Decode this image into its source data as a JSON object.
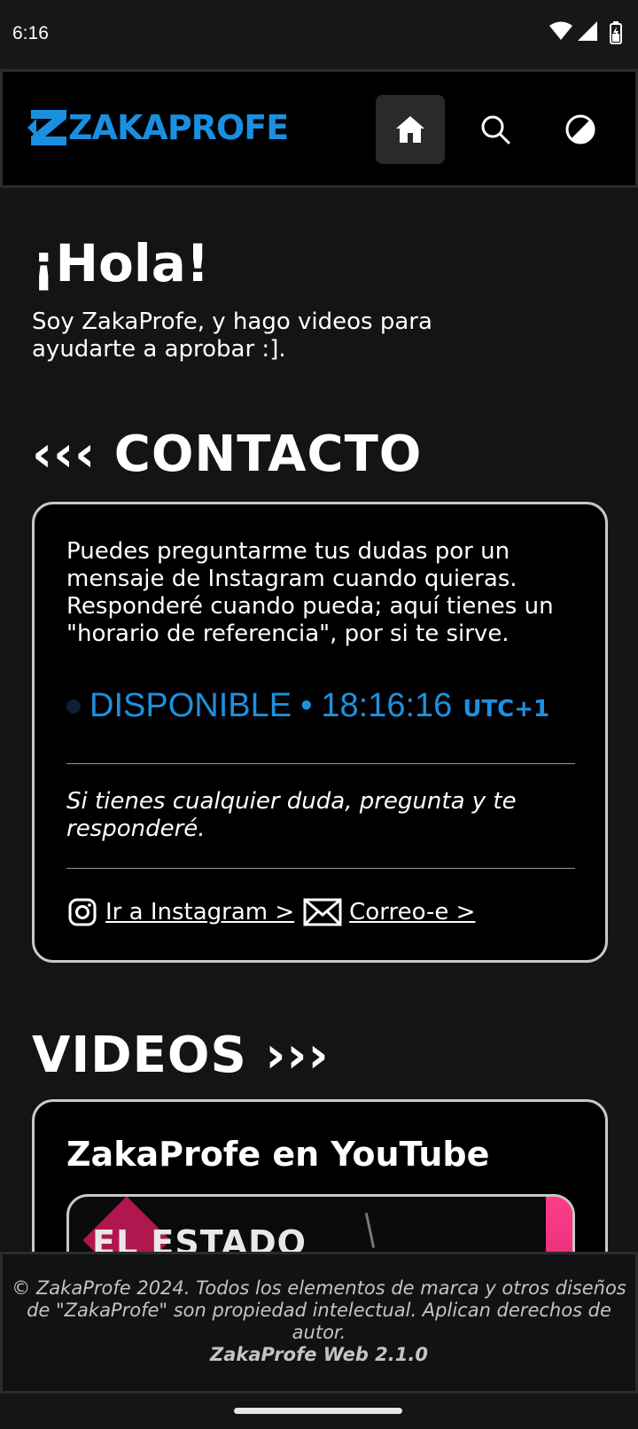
{
  "status_bar": {
    "time": "6:16"
  },
  "header": {
    "logo_text": "ZAKAPROFE",
    "nav": [
      "home-icon",
      "search-icon",
      "contrast-icon"
    ]
  },
  "intro": {
    "greeting": "¡Hola!",
    "text": "Soy ZakaProfe, y hago videos para ayudarte a aprobar :]."
  },
  "contact": {
    "title": "‹‹‹ CONTACTO",
    "p1": "Puedes preguntarme tus dudas por un mensaje de Instagram cuando quieras.",
    "p2": "Responderé cuando pueda; aquí tienes un \"horario de referencia\", por si te sirve.",
    "availability": {
      "status": "DISPONIBLE",
      "separator": "•",
      "time": "18:16:16",
      "timezone": "UTC+1",
      "color": "#1e90e0"
    },
    "note": "Si tienes cualquier duda, pregunta y te responderé.",
    "links": {
      "instagram": "Ir a Instagram >",
      "email": "Correo-e >"
    }
  },
  "videos": {
    "title": "VIDEOS ›››",
    "card_title": "ZakaProfe en YouTube",
    "thumbnail_text": "EL ESTADO"
  },
  "footer": {
    "copyright": "© ZakaProfe 2024. Todos los elementos de marca y otros diseños de \"ZakaProfe\" son propiedad intelectual. Aplican derechos de autor.",
    "version": "ZakaProfe Web 2.1.0"
  },
  "colors": {
    "accent": "#1a8fe0",
    "background": "#141416",
    "card": "#000000"
  }
}
